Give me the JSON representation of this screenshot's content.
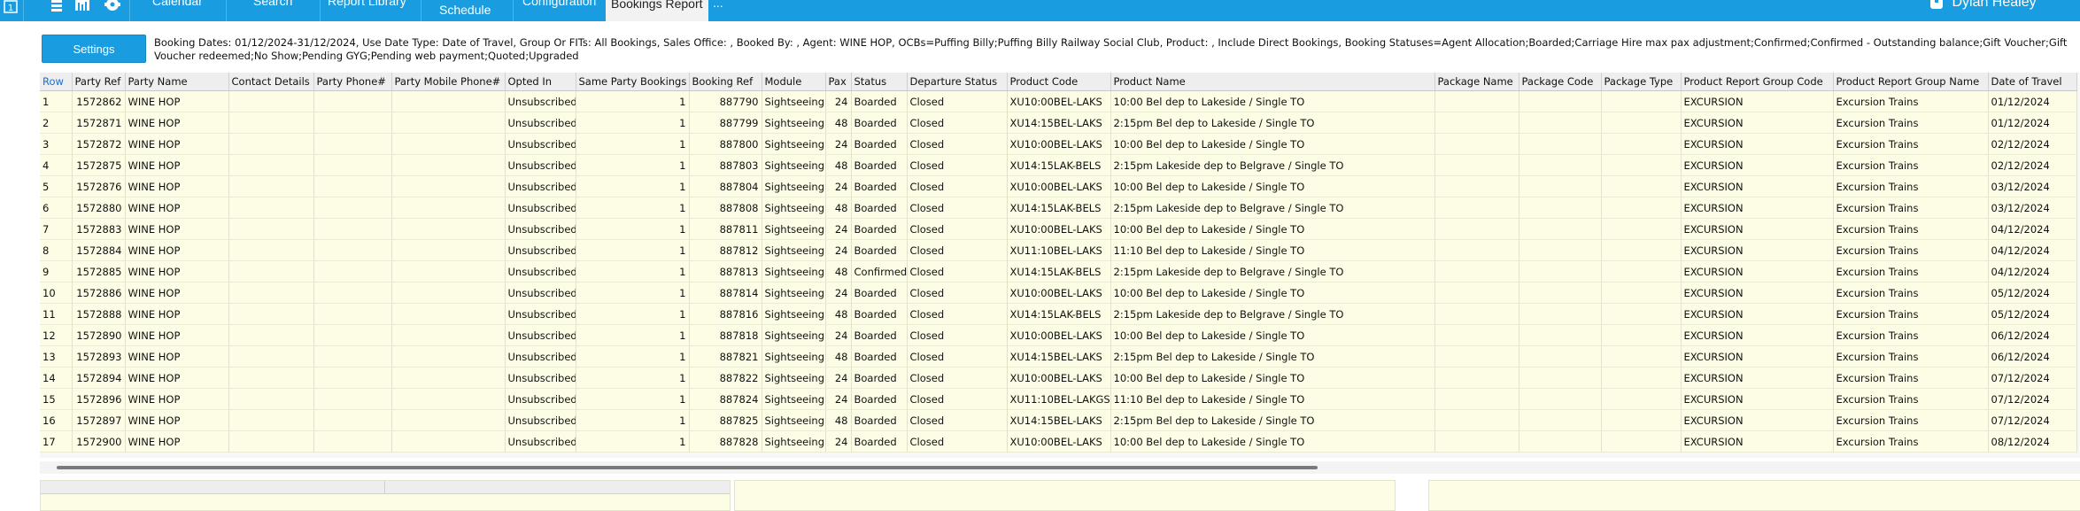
{
  "nav": {
    "tab_number": "1",
    "tabs": [
      "Calendar",
      "Search",
      "Report Library",
      "Schedule",
      "Configuration",
      "Bookings Report"
    ],
    "more": "...",
    "user_name": "Dylan Healey"
  },
  "settings": {
    "button_label": "Settings"
  },
  "criteria": {
    "text": "Booking Dates: 01/12/2024-31/12/2024, Use Date Type: Date of Travel, Group Or FITs: All Bookings, Sales Office: , Booked By: , Agent: WINE HOP, OCBs=Puffing Billy;Puffing Billy Railway Social Club, Product: , Include Direct Bookings, Booking Statuses=Agent Allocation;Boarded;Carriage Hire max pax adjustment;Confirmed;Confirmed - Outstanding balance;Gift Voucher;Gift Voucher redeemed;No Show;Pending GYG;Pending web payment;Quoted;Upgraded"
  },
  "table": {
    "headers": [
      "Row",
      "Party Ref",
      "Party Name",
      "Contact Details",
      "Party Phone#",
      "Party Mobile Phone#",
      "Opted In",
      "Same Party Bookings",
      "Booking Ref",
      "Module",
      "Pax",
      "Status",
      "Departure Status",
      "Product Code",
      "Product Name",
      "Package Name",
      "Package Code",
      "Package Type",
      "Product  Report Group Code",
      "Product  Report Group Name",
      "Date of Travel"
    ],
    "rows": [
      [
        "1",
        "1572862",
        "WINE HOP",
        "",
        "",
        "",
        "Unsubscribed",
        "1",
        "887790",
        "Sightseeing",
        "24",
        "Boarded",
        "Closed",
        "XU10:00BEL-LAKS",
        "10:00 Bel dep to Lakeside / Single TO",
        "",
        "",
        "",
        "EXCURSION",
        "Excursion Trains",
        "01/12/2024"
      ],
      [
        "2",
        "1572871",
        "WINE HOP",
        "",
        "",
        "",
        "Unsubscribed",
        "1",
        "887799",
        "Sightseeing",
        "48",
        "Boarded",
        "Closed",
        "XU14:15BEL-LAKS",
        "2:15pm Bel dep to Lakeside / Single TO",
        "",
        "",
        "",
        "EXCURSION",
        "Excursion Trains",
        "01/12/2024"
      ],
      [
        "3",
        "1572872",
        "WINE HOP",
        "",
        "",
        "",
        "Unsubscribed",
        "1",
        "887800",
        "Sightseeing",
        "24",
        "Boarded",
        "Closed",
        "XU10:00BEL-LAKS",
        "10:00 Bel dep to Lakeside / Single TO",
        "",
        "",
        "",
        "EXCURSION",
        "Excursion Trains",
        "02/12/2024"
      ],
      [
        "4",
        "1572875",
        "WINE HOP",
        "",
        "",
        "",
        "Unsubscribed",
        "1",
        "887803",
        "Sightseeing",
        "48",
        "Boarded",
        "Closed",
        "XU14:15LAK-BELS",
        "2:15pm Lakeside dep to Belgrave / Single TO",
        "",
        "",
        "",
        "EXCURSION",
        "Excursion Trains",
        "02/12/2024"
      ],
      [
        "5",
        "1572876",
        "WINE HOP",
        "",
        "",
        "",
        "Unsubscribed",
        "1",
        "887804",
        "Sightseeing",
        "24",
        "Boarded",
        "Closed",
        "XU10:00BEL-LAKS",
        "10:00 Bel dep to Lakeside / Single TO",
        "",
        "",
        "",
        "EXCURSION",
        "Excursion Trains",
        "03/12/2024"
      ],
      [
        "6",
        "1572880",
        "WINE HOP",
        "",
        "",
        "",
        "Unsubscribed",
        "1",
        "887808",
        "Sightseeing",
        "48",
        "Boarded",
        "Closed",
        "XU14:15LAK-BELS",
        "2:15pm Lakeside dep to Belgrave / Single TO",
        "",
        "",
        "",
        "EXCURSION",
        "Excursion Trains",
        "03/12/2024"
      ],
      [
        "7",
        "1572883",
        "WINE HOP",
        "",
        "",
        "",
        "Unsubscribed",
        "1",
        "887811",
        "Sightseeing",
        "24",
        "Boarded",
        "Closed",
        "XU10:00BEL-LAKS",
        "10:00 Bel dep to Lakeside / Single TO",
        "",
        "",
        "",
        "EXCURSION",
        "Excursion Trains",
        "04/12/2024"
      ],
      [
        "8",
        "1572884",
        "WINE HOP",
        "",
        "",
        "",
        "Unsubscribed",
        "1",
        "887812",
        "Sightseeing",
        "24",
        "Boarded",
        "Closed",
        "XU11:10BEL-LAKS",
        "11:10 Bel dep to Lakeside / Single TO",
        "",
        "",
        "",
        "EXCURSION",
        "Excursion Trains",
        "04/12/2024"
      ],
      [
        "9",
        "1572885",
        "WINE HOP",
        "",
        "",
        "",
        "Unsubscribed",
        "1",
        "887813",
        "Sightseeing",
        "48",
        "Confirmed",
        "Closed",
        "XU14:15LAK-BELS",
        "2:15pm Lakeside dep to Belgrave / Single TO",
        "",
        "",
        "",
        "EXCURSION",
        "Excursion Trains",
        "04/12/2024"
      ],
      [
        "10",
        "1572886",
        "WINE HOP",
        "",
        "",
        "",
        "Unsubscribed",
        "1",
        "887814",
        "Sightseeing",
        "24",
        "Boarded",
        "Closed",
        "XU10:00BEL-LAKS",
        "10:00 Bel dep to Lakeside / Single TO",
        "",
        "",
        "",
        "EXCURSION",
        "Excursion Trains",
        "05/12/2024"
      ],
      [
        "11",
        "1572888",
        "WINE HOP",
        "",
        "",
        "",
        "Unsubscribed",
        "1",
        "887816",
        "Sightseeing",
        "48",
        "Boarded",
        "Closed",
        "XU14:15LAK-BELS",
        "2:15pm Lakeside dep to Belgrave / Single TO",
        "",
        "",
        "",
        "EXCURSION",
        "Excursion Trains",
        "05/12/2024"
      ],
      [
        "12",
        "1572890",
        "WINE HOP",
        "",
        "",
        "",
        "Unsubscribed",
        "1",
        "887818",
        "Sightseeing",
        "24",
        "Boarded",
        "Closed",
        "XU10:00BEL-LAKS",
        "10:00 Bel dep to Lakeside / Single TO",
        "",
        "",
        "",
        "EXCURSION",
        "Excursion Trains",
        "06/12/2024"
      ],
      [
        "13",
        "1572893",
        "WINE HOP",
        "",
        "",
        "",
        "Unsubscribed",
        "1",
        "887821",
        "Sightseeing",
        "48",
        "Boarded",
        "Closed",
        "XU14:15BEL-LAKS",
        "2:15pm Bel dep to Lakeside / Single TO",
        "",
        "",
        "",
        "EXCURSION",
        "Excursion Trains",
        "06/12/2024"
      ],
      [
        "14",
        "1572894",
        "WINE HOP",
        "",
        "",
        "",
        "Unsubscribed",
        "1",
        "887822",
        "Sightseeing",
        "24",
        "Boarded",
        "Closed",
        "XU10:00BEL-LAKS",
        "10:00 Bel dep to Lakeside / Single TO",
        "",
        "",
        "",
        "EXCURSION",
        "Excursion Trains",
        "07/12/2024"
      ],
      [
        "15",
        "1572896",
        "WINE HOP",
        "",
        "",
        "",
        "Unsubscribed",
        "1",
        "887824",
        "Sightseeing",
        "24",
        "Boarded",
        "Closed",
        "XU11:10BEL-LAKGS",
        "11:10 Bel dep to Lakeside / Single TO",
        "",
        "",
        "",
        "EXCURSION",
        "Excursion Trains",
        "07/12/2024"
      ],
      [
        "16",
        "1572897",
        "WINE HOP",
        "",
        "",
        "",
        "Unsubscribed",
        "1",
        "887825",
        "Sightseeing",
        "48",
        "Boarded",
        "Closed",
        "XU14:15BEL-LAKS",
        "2:15pm Bel dep to Lakeside / Single TO",
        "",
        "",
        "",
        "EXCURSION",
        "Excursion Trains",
        "07/12/2024"
      ],
      [
        "17",
        "1572900",
        "WINE HOP",
        "",
        "",
        "",
        "Unsubscribed",
        "1",
        "887828",
        "Sightseeing",
        "24",
        "Boarded",
        "Closed",
        "XU10:00BEL-LAKS",
        "10:00 Bel dep to Lakeside / Single TO",
        "",
        "",
        "",
        "EXCURSION",
        "Excursion Trains",
        "08/12/2024"
      ]
    ]
  },
  "colors": {
    "nav_blue": "#1a9ce0",
    "row_yellow": "#fdfde6",
    "header_grey": "#eeeeee",
    "row_link_blue": "#1a6fd0"
  },
  "icons": {
    "tab_number": "numbered-tab-icon",
    "list": "list-icon",
    "chart": "bar-chart-icon",
    "settings": "gear-icon",
    "user": "user-icon"
  }
}
